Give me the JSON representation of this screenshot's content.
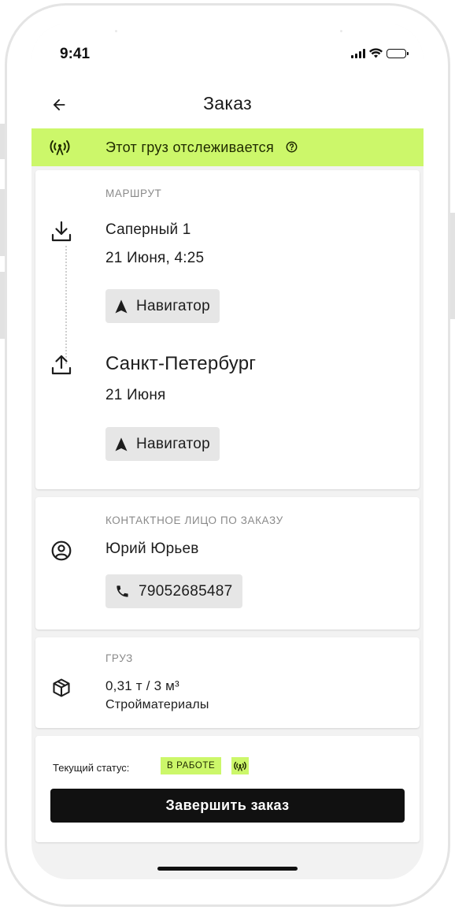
{
  "status_bar": {
    "time": "9:41"
  },
  "header": {
    "title": "Заказ",
    "back_icon": "arrow-left-icon"
  },
  "tracking_banner": {
    "text": "Этот груз отслеживается",
    "icon": "tracking-icon",
    "help_icon": "help-circle-icon",
    "color": "#ccf76a"
  },
  "route": {
    "label": "МАРШРУТ",
    "loading": {
      "icon": "download-icon",
      "address": "Саперный 1",
      "datetime": "21 Июня, 4:25",
      "navigator_label": "Навигатор"
    },
    "unloading": {
      "icon": "upload-icon",
      "address": "Санкт-Петербург",
      "date": "21 Июня",
      "navigator_label": "Навигатор"
    }
  },
  "contact": {
    "label": "КОНТАКТНОЕ ЛИЦО ПО ЗАКАЗУ",
    "icon": "user-circle-icon",
    "name": "Юрий Юрьев",
    "phone": "79052685487",
    "phone_icon": "phone-icon"
  },
  "cargo": {
    "label": "ГРУЗ",
    "icon": "package-icon",
    "amount": "0,31 т / 3 м³",
    "type": "Стройматериалы"
  },
  "status": {
    "label": "Текущий статус:",
    "value": "В РАБОТЕ",
    "finish_button": "Завершить заказ"
  },
  "colors": {
    "accent": "#ccf76a",
    "button": "#111111",
    "background": "#f2f2f2"
  }
}
